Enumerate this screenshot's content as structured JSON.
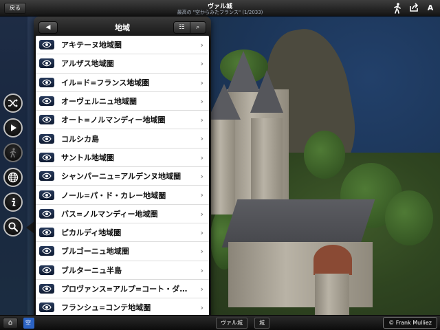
{
  "topbar": {
    "back_label": "戻る",
    "title": "ヴァル城",
    "subtitle": "最高の \"空からみたフランス\" (1/2033)",
    "icons": [
      "walk-icon",
      "share-icon",
      "font-size-icon"
    ],
    "font_icon_glyph": "A"
  },
  "sidebar": {
    "buttons": [
      "shuffle-icon",
      "play-icon",
      "walk-disabled-icon",
      "globe-icon",
      "info-icon",
      "search-icon"
    ]
  },
  "popover": {
    "back_glyph": "◀",
    "title": "地域",
    "list_view_glyph": "☷",
    "search_glyph": "⌕",
    "items": [
      "アキテーヌ地域圏",
      "アルザス地域圏",
      "イル=ド=フランス地域圏",
      "オーヴェルニュ地域圏",
      "オート=ノルマンディー地域圏",
      "コルシカ島",
      "サントル地域圏",
      "シャンパーニュ=アルデンヌ地域圏",
      "ノール=パ・ド・カレー地域圏",
      "バス=ノルマンディー地域圏",
      "ピカルディ地域圏",
      "ブルゴーニュ地域圏",
      "ブルターニュ半島",
      "プロヴァンス=アルプ=コート・ダジュール地域圏",
      "フランシュ=コンテ地域圏"
    ],
    "chevron": "›"
  },
  "bottombar": {
    "home_glyph": "⌂",
    "active_crumb": "空",
    "crumbs": [
      "ヴァル城",
      "城"
    ],
    "credit": "© Frank Mulliez"
  },
  "colors": {
    "accent_blue": "#2b63c4",
    "list_icon_bg": "#1a2a48"
  }
}
